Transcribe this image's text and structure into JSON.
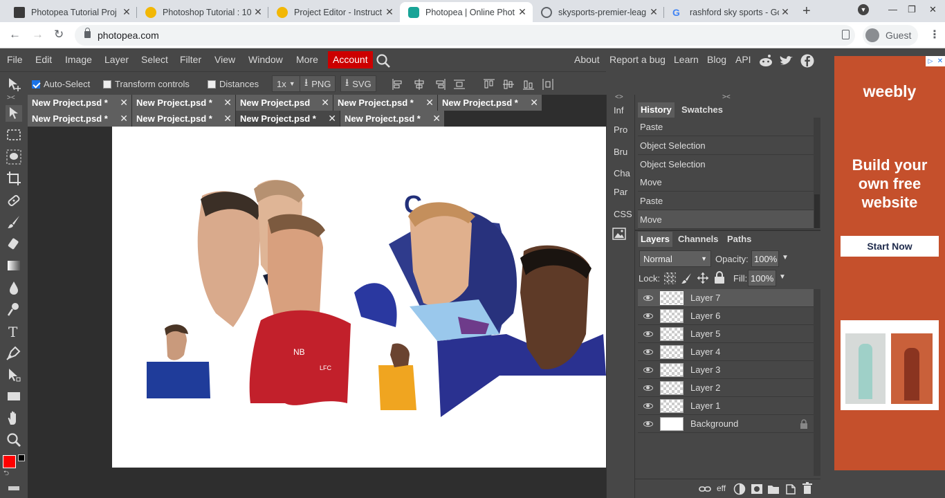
{
  "browser": {
    "tabs": [
      {
        "title": "Photopea Tutorial Proj",
        "active": false
      },
      {
        "title": "Photoshop Tutorial : 10",
        "active": false
      },
      {
        "title": "Project Editor - Instruct",
        "active": false
      },
      {
        "title": "Photopea | Online Phot",
        "active": true
      },
      {
        "title": "skysports-premier-leag",
        "active": false
      },
      {
        "title": "rashford sky sports - Go",
        "active": false
      }
    ],
    "url": "photopea.com",
    "profile": "Guest"
  },
  "menu": {
    "items": [
      "File",
      "Edit",
      "Image",
      "Layer",
      "Select",
      "Filter",
      "View",
      "Window",
      "More"
    ],
    "account": "Account",
    "right_links": [
      "About",
      "Report a bug",
      "Learn",
      "Blog",
      "API"
    ]
  },
  "options": {
    "auto_select": "Auto-Select",
    "transform_controls": "Transform controls",
    "distances": "Distances",
    "zoom": "1x",
    "png": "PNG",
    "svg": "SVG"
  },
  "doc_tabs": {
    "row1": [
      "New Project.psd *",
      "New Project.psd *",
      "New Project.psd",
      "New Project.psd *",
      "New Project.psd *"
    ],
    "row2": [
      "New Project.psd *",
      "New Project.psd *",
      "New Project.psd *",
      "New Project.psd *"
    ]
  },
  "side_mini": [
    "Inf",
    "Pro",
    "Bru",
    "Cha",
    "Par",
    "CSS"
  ],
  "history": {
    "tabs": [
      "History",
      "Swatches"
    ],
    "items": [
      "Paste",
      "Object Selection",
      "Object Selection",
      "Move",
      "Paste",
      "Move"
    ]
  },
  "layers": {
    "tabs": [
      "Layers",
      "Channels",
      "Paths"
    ],
    "blend_mode": "Normal",
    "opacity_label": "Opacity:",
    "opacity": "100%",
    "lock_label": "Lock:",
    "fill_label": "Fill:",
    "fill": "100%",
    "items": [
      "Layer 7",
      "Layer 6",
      "Layer 5",
      "Layer 4",
      "Layer 3",
      "Layer 2",
      "Layer 1",
      "Background"
    ],
    "footer_eff": "eff"
  },
  "ad": {
    "brand": "weebly",
    "headline": "Build your own free website",
    "cta": "Start Now"
  },
  "colors": {
    "foreground": "#ff0000",
    "background": "#000000",
    "account": "#cc0000",
    "ad": "#c5502c"
  }
}
